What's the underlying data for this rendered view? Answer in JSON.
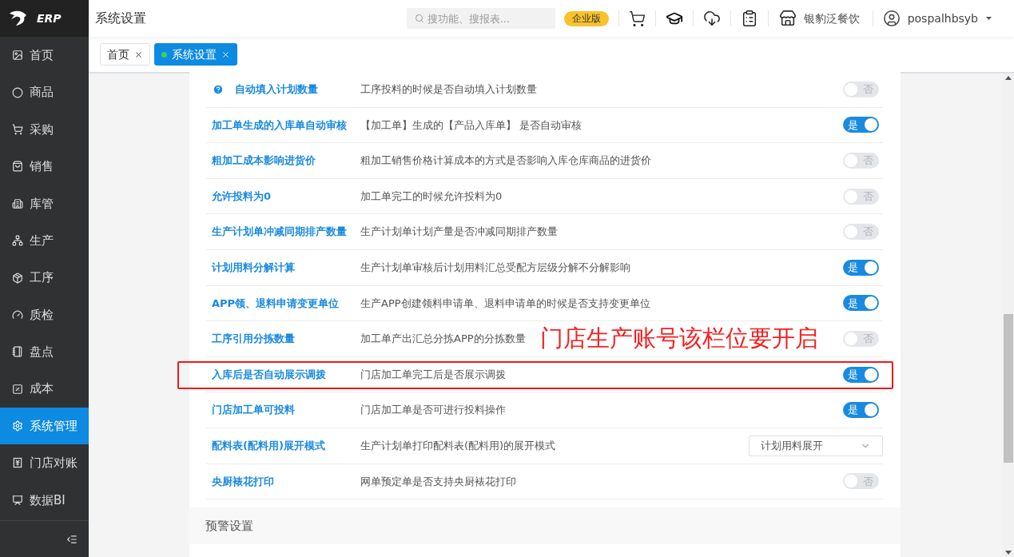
{
  "logo": {
    "text": "ERP"
  },
  "header": {
    "title": "系统设置",
    "search": {
      "placeholder": "搜功能、搜报表..."
    },
    "edition_badge": "企业版",
    "store_name": "银豹泛餐饮",
    "user_name": "pospalhbsyb"
  },
  "sidebar": {
    "items": [
      {
        "label": "首页",
        "selected": false
      },
      {
        "label": "商品",
        "selected": false
      },
      {
        "label": "采购",
        "selected": false
      },
      {
        "label": "销售",
        "selected": false
      },
      {
        "label": "库管",
        "selected": false
      },
      {
        "label": "生产",
        "selected": false
      },
      {
        "label": "工序",
        "selected": false
      },
      {
        "label": "质检",
        "selected": false
      },
      {
        "label": "盘点",
        "selected": false
      },
      {
        "label": "成本",
        "selected": false
      },
      {
        "label": "系统管理",
        "selected": true
      },
      {
        "label": "门店对账",
        "selected": false
      },
      {
        "label": "数据BI",
        "selected": false
      }
    ]
  },
  "tabs": [
    {
      "label": "首页",
      "selected": false
    },
    {
      "label": "系统设置",
      "selected": true
    }
  ],
  "settings": {
    "rows": [
      {
        "kind": "toggle",
        "name": "自动填入计划数量",
        "help": true,
        "description": "工序投料的时候是否自动填入计划数量",
        "on": false,
        "toggle_text": "否",
        "highlighted": false
      },
      {
        "kind": "toggle",
        "name": "加工单生成的入库单自动审核",
        "help": false,
        "description": "【加工单】生成的【产品入库单】 是否自动审核",
        "on": true,
        "toggle_text": "是",
        "highlighted": false
      },
      {
        "kind": "toggle",
        "name": "粗加工成本影响进货价",
        "help": false,
        "description": "粗加工销售价格计算成本的方式是否影响入库仓库商品的进货价",
        "on": false,
        "toggle_text": "否",
        "highlighted": false
      },
      {
        "kind": "toggle",
        "name": "允许投料为0",
        "help": false,
        "description": "加工单完工的时候允许投料为0",
        "on": false,
        "toggle_text": "否",
        "highlighted": false
      },
      {
        "kind": "toggle",
        "name": "生产计划单冲减同期排产数量",
        "help": false,
        "description": "生产计划单计划产量是否冲减同期排产数量",
        "on": false,
        "toggle_text": "否",
        "highlighted": false
      },
      {
        "kind": "toggle",
        "name": "计划用料分解计算",
        "help": false,
        "description": "生产计划单审核后计划用料汇总受配方层级分解不分解影响",
        "on": true,
        "toggle_text": "是",
        "highlighted": false
      },
      {
        "kind": "toggle",
        "name": "APP领、退料申请变更单位",
        "help": false,
        "description": "生产APP创建领料申请单、退料申请单的时候是否支持变更单位",
        "on": true,
        "toggle_text": "是",
        "highlighted": false
      },
      {
        "kind": "toggle",
        "name": "工序引用分拣数量",
        "help": false,
        "description": "加工单产出汇总分拣APP的分拣数量",
        "on": false,
        "toggle_text": "否",
        "highlighted": false,
        "note": "门店生产账号该栏位要开启"
      },
      {
        "kind": "toggle",
        "name": "入库后是否自动展示调拨",
        "help": false,
        "description": "门店加工单完工后是否展示调拨",
        "on": true,
        "toggle_text": "是",
        "highlighted": true
      },
      {
        "kind": "toggle",
        "name": "门店加工单可投料",
        "help": false,
        "description": "门店加工单是否可进行投料操作",
        "on": true,
        "toggle_text": "是",
        "highlighted": false
      },
      {
        "kind": "select",
        "name": "配料表(配料用)展开模式",
        "help": false,
        "description": "生产计划单打印配料表(配料用)的展开模式",
        "value": "计划用料展开",
        "highlighted": false
      },
      {
        "kind": "toggle",
        "name": "央厨裱花打印",
        "help": false,
        "description": "网单预定单是否支持央厨裱花打印",
        "on": false,
        "toggle_text": "否",
        "highlighted": false
      }
    ]
  },
  "next_section": {
    "title": "预警设置"
  }
}
